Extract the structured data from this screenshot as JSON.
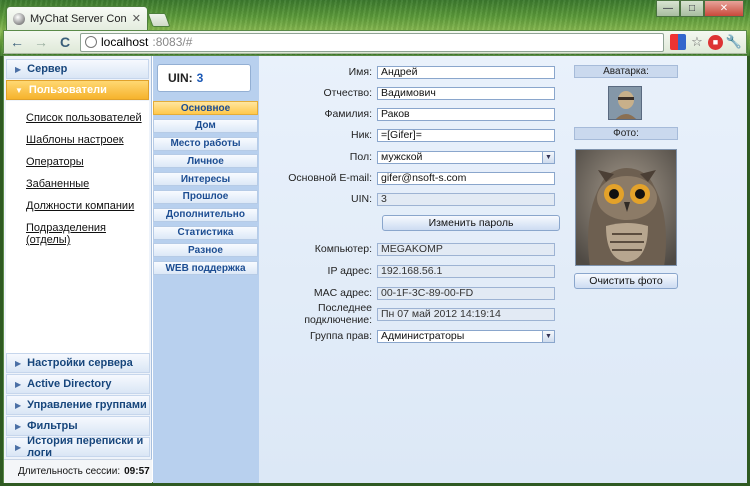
{
  "browser": {
    "tab_title": "MyChat Server Console",
    "tab_close": "✕",
    "url_host": "localhost",
    "url_rest": ":8083/#",
    "back_glyph": "←",
    "forward_glyph": "→",
    "reload_glyph": "C",
    "star_glyph": "☆",
    "wrench_glyph": "🔧",
    "min_glyph": "—",
    "max_glyph": "□",
    "close_glyph": "✕"
  },
  "sidebar": {
    "top_sections": [
      {
        "label": "Сервер"
      },
      {
        "label": "Пользователи"
      }
    ],
    "items": [
      {
        "label": "Список пользователей"
      },
      {
        "label": "Шаблоны настроек"
      },
      {
        "label": "Операторы"
      },
      {
        "label": "Забаненные"
      },
      {
        "label": "Должности компании"
      },
      {
        "label": "Подразделения (отделы)"
      }
    ],
    "bottom_sections": [
      {
        "label": "Настройки сервера"
      },
      {
        "label": "Active Directory"
      },
      {
        "label": "Управление группами"
      },
      {
        "label": "Фильтры"
      },
      {
        "label": "История переписки и логи"
      }
    ],
    "session_label": "Длительность сессии:",
    "session_value": "09:57"
  },
  "uin_box": {
    "label": "UIN:",
    "value": "3"
  },
  "vtabs": [
    {
      "label": "Основное"
    },
    {
      "label": "Дом"
    },
    {
      "label": "Место работы"
    },
    {
      "label": "Личное"
    },
    {
      "label": "Интересы"
    },
    {
      "label": "Прошлое"
    },
    {
      "label": "Дополнительно"
    },
    {
      "label": "Статистика"
    },
    {
      "label": "Разное"
    },
    {
      "label": "WEB поддержка"
    }
  ],
  "form": {
    "first_name": {
      "label": "Имя:",
      "value": "Андрей"
    },
    "patronymic": {
      "label": "Отчество:",
      "value": "Вадимович"
    },
    "last_name": {
      "label": "Фамилия:",
      "value": "Раков"
    },
    "nick": {
      "label": "Ник:",
      "value": "=[Gifer]="
    },
    "gender": {
      "label": "Пол:",
      "value": "мужской"
    },
    "email": {
      "label": "Основной E-mail:",
      "value": "gifer@nsoft-s.com"
    },
    "uin": {
      "label": "UIN:",
      "value": "3"
    },
    "change_password": "Изменить пароль",
    "computer": {
      "label": "Компьютер:",
      "value": "MEGAKOMP"
    },
    "ip": {
      "label": "IP адрес:",
      "value": "192.168.56.1"
    },
    "mac": {
      "label": "MAC адрес:",
      "value": "00-1F-3C-89-00-FD"
    },
    "last_login": {
      "label": "Последнее подключение:",
      "value": "Пн 07 май 2012 14:19:14"
    },
    "group": {
      "label": "Группа прав:",
      "value": "Администраторы"
    }
  },
  "media": {
    "avatar_caption": "Аватарка:",
    "photo_caption": "Фото:",
    "clear_photo": "Очистить фото"
  }
}
